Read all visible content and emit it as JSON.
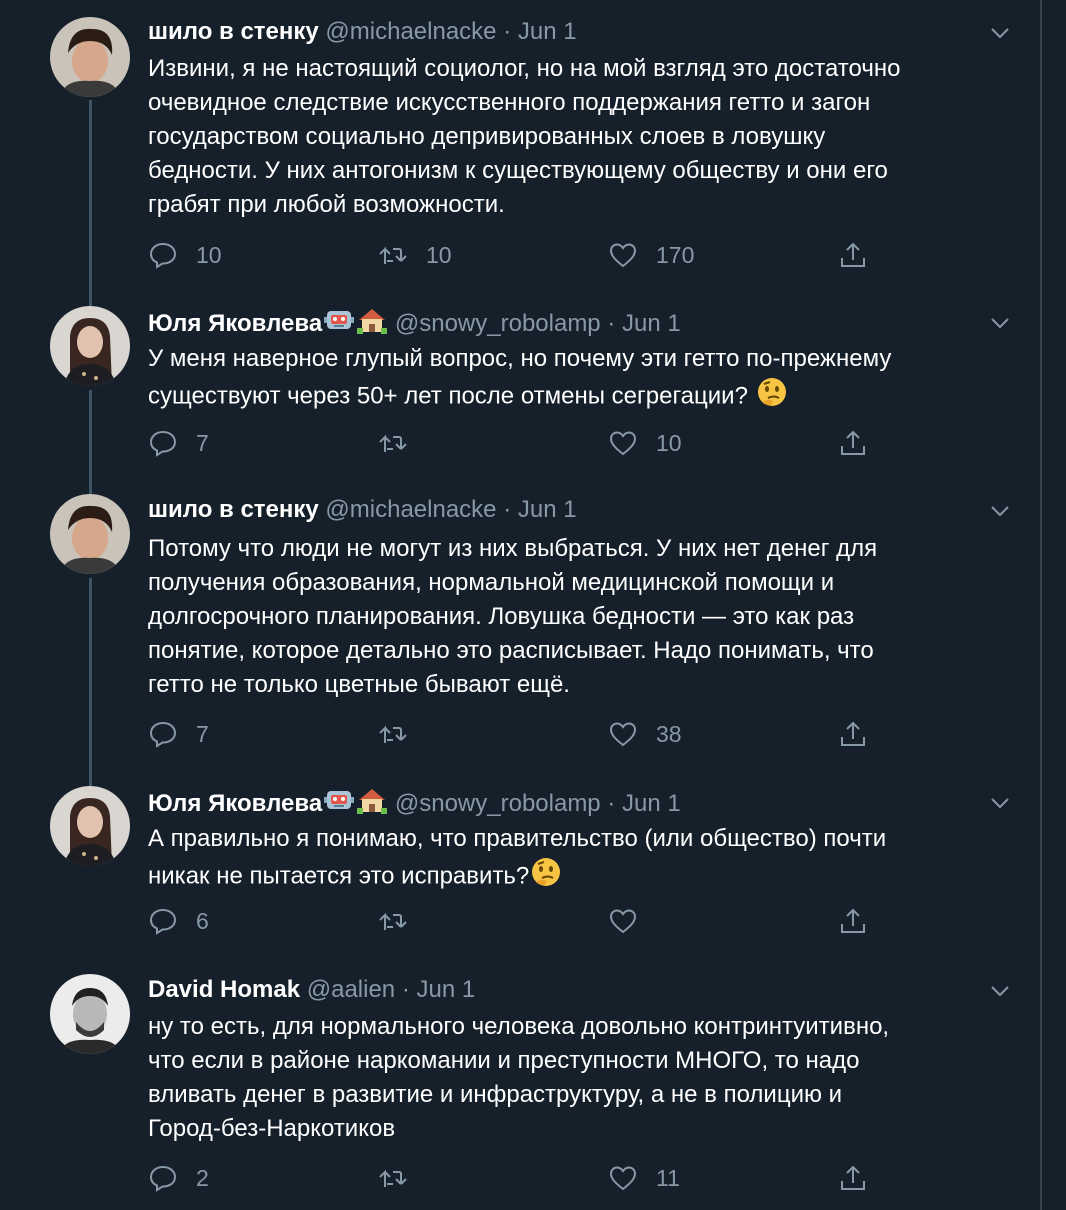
{
  "colors": {
    "background": "#15202b",
    "secondary_text": "#8899a6",
    "thread_line": "#3d5466",
    "border": "#38444d"
  },
  "tweets": [
    {
      "name": "шило в стенку",
      "handle": "@michaelnacke",
      "sep": "·",
      "date": "Jun 1",
      "name_emoji": [],
      "text": "Извини, я не настоящий социолог, но на мой взгляд это достаточно\nочевидное следствие искусственного поддержания гетто и загон\nгосударством социально депривированных слоев в ловушку\nбедности. У них антогонизм к существующему обществу и они его\nграбят при любой возможности.",
      "replies": "10",
      "retweets": "10",
      "likes": "170"
    },
    {
      "name": "Юля Яковлева",
      "handle": "@snowy_robolamp",
      "sep": "·",
      "date": "Jun 1",
      "name_emoji": [
        "robot-emoji",
        "house-emoji"
      ],
      "text": "У меня наверное глупый вопрос, но почему эти гетто по-прежнему\nсуществуют через 50+ лет после отмены сегрегации?",
      "text_emoji": "thinking-face-emoji",
      "replies": "7",
      "retweets": "",
      "likes": "10"
    },
    {
      "name": "шило в стенку",
      "handle": "@michaelnacke",
      "sep": "·",
      "date": "Jun 1",
      "name_emoji": [],
      "text": "Потому что люди не могут из них выбраться. У них нет денег для\nполучения образования, нормальной медицинской помощи и\nдолгосрочного планирования. Ловушка бедности — это как раз\nпонятие, которое детально это расписывает. Надо понимать, что\nгетто не только цветные бывают ещё.",
      "replies": "7",
      "retweets": "",
      "likes": "38"
    },
    {
      "name": "Юля Яковлева",
      "handle": "@snowy_robolamp",
      "sep": "·",
      "date": "Jun 1",
      "name_emoji": [
        "robot-emoji",
        "house-emoji"
      ],
      "text": "А правильно я понимаю, что правительство (или общество) почти\nникак не пытается это исправить?",
      "text_emoji": "thinking-face-emoji",
      "replies": "6",
      "retweets": "",
      "likes": ""
    },
    {
      "name": "David Homak",
      "handle": "@aalien",
      "sep": "·",
      "date": "Jun 1",
      "name_emoji": [],
      "text": "ну то есть, для нормального человека довольно контринтуитивно,\nчто если в районе наркомании и преступности МНОГО, то надо\nвливать денег в развитие и инфраструктуру, а не в полицию и\nГород-без-Наркотиков",
      "replies": "2",
      "retweets": "",
      "likes": "11"
    }
  ]
}
